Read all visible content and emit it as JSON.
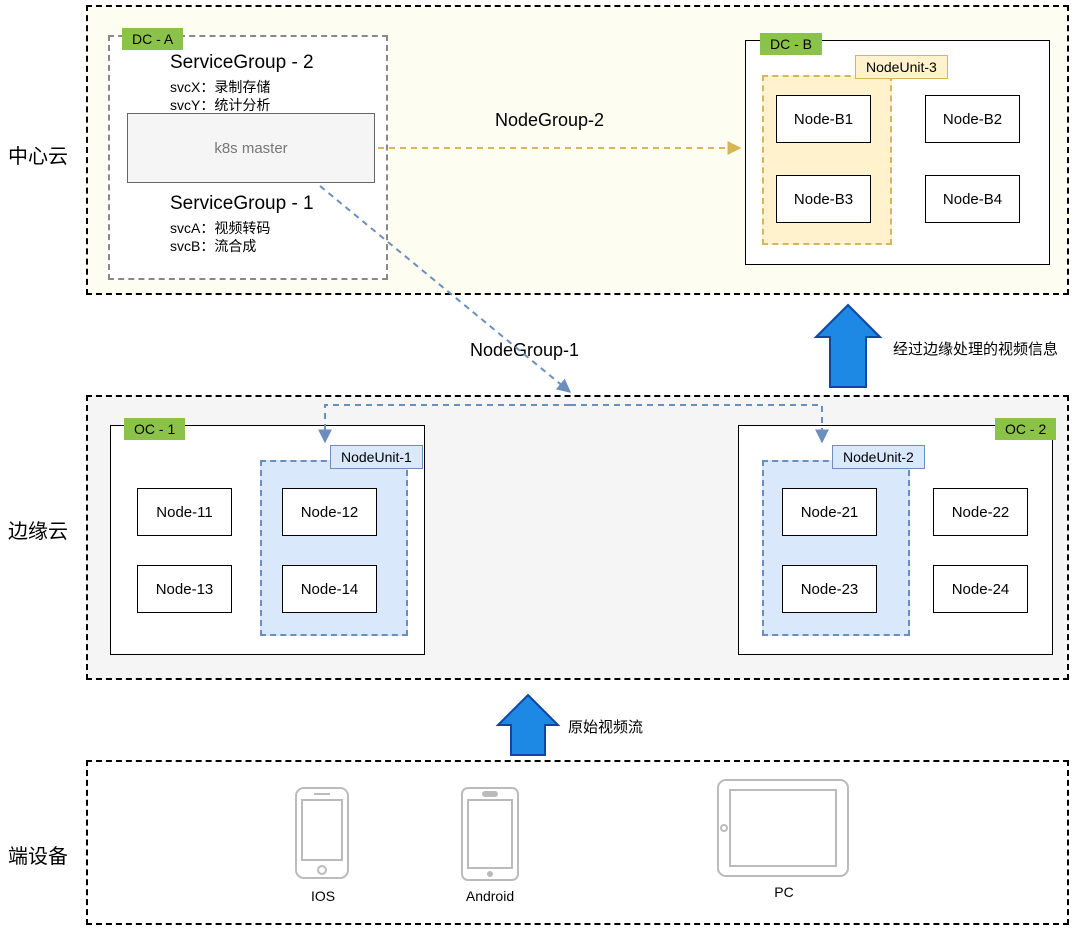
{
  "layers": {
    "center_cloud": "中心云",
    "edge_cloud": "边缘云",
    "devices": "端设备"
  },
  "center": {
    "bg_fill": "#fdfdf2",
    "dc_a": {
      "tag": "DC - A",
      "sg2": {
        "title": "ServiceGroup - 2",
        "svcX": "svcX：录制存储",
        "svcY": "svcY：统计分析"
      },
      "k8s": "k8s master",
      "sg1": {
        "title": "ServiceGroup - 1",
        "svcA": "svcA：视频转码",
        "svcB": "svcB：流合成"
      }
    },
    "dc_b": {
      "tag": "DC - B",
      "nodeunit3": "NodeUnit-3",
      "nodes": {
        "b1": "Node-B1",
        "b2": "Node-B2",
        "b3": "Node-B3",
        "b4": "Node-B4"
      }
    },
    "nodegroup2": "NodeGroup-2"
  },
  "edge": {
    "bg_fill": "#f5f5f5",
    "nodegroup1": "NodeGroup-1",
    "oc1": {
      "tag": "OC - 1",
      "nodeunit1": "NodeUnit-1",
      "nodes": {
        "n11": "Node-11",
        "n12": "Node-12",
        "n13": "Node-13",
        "n14": "Node-14"
      }
    },
    "oc2": {
      "tag": "OC - 2",
      "nodeunit2": "NodeUnit-2",
      "nodes": {
        "n21": "Node-21",
        "n22": "Node-22",
        "n23": "Node-23",
        "n24": "Node-24"
      }
    }
  },
  "arrows": {
    "up1_label": "原始视频流",
    "up2_label": "经过边缘处理的视频信息"
  },
  "devices": {
    "ios": "IOS",
    "android": "Android",
    "pc": "PC"
  },
  "colors": {
    "yellow_line": "#d6b656",
    "blue_line": "#6c8ebf",
    "arrow_fill": "#1e88e5",
    "arrow_stroke": "#0d47a1"
  }
}
